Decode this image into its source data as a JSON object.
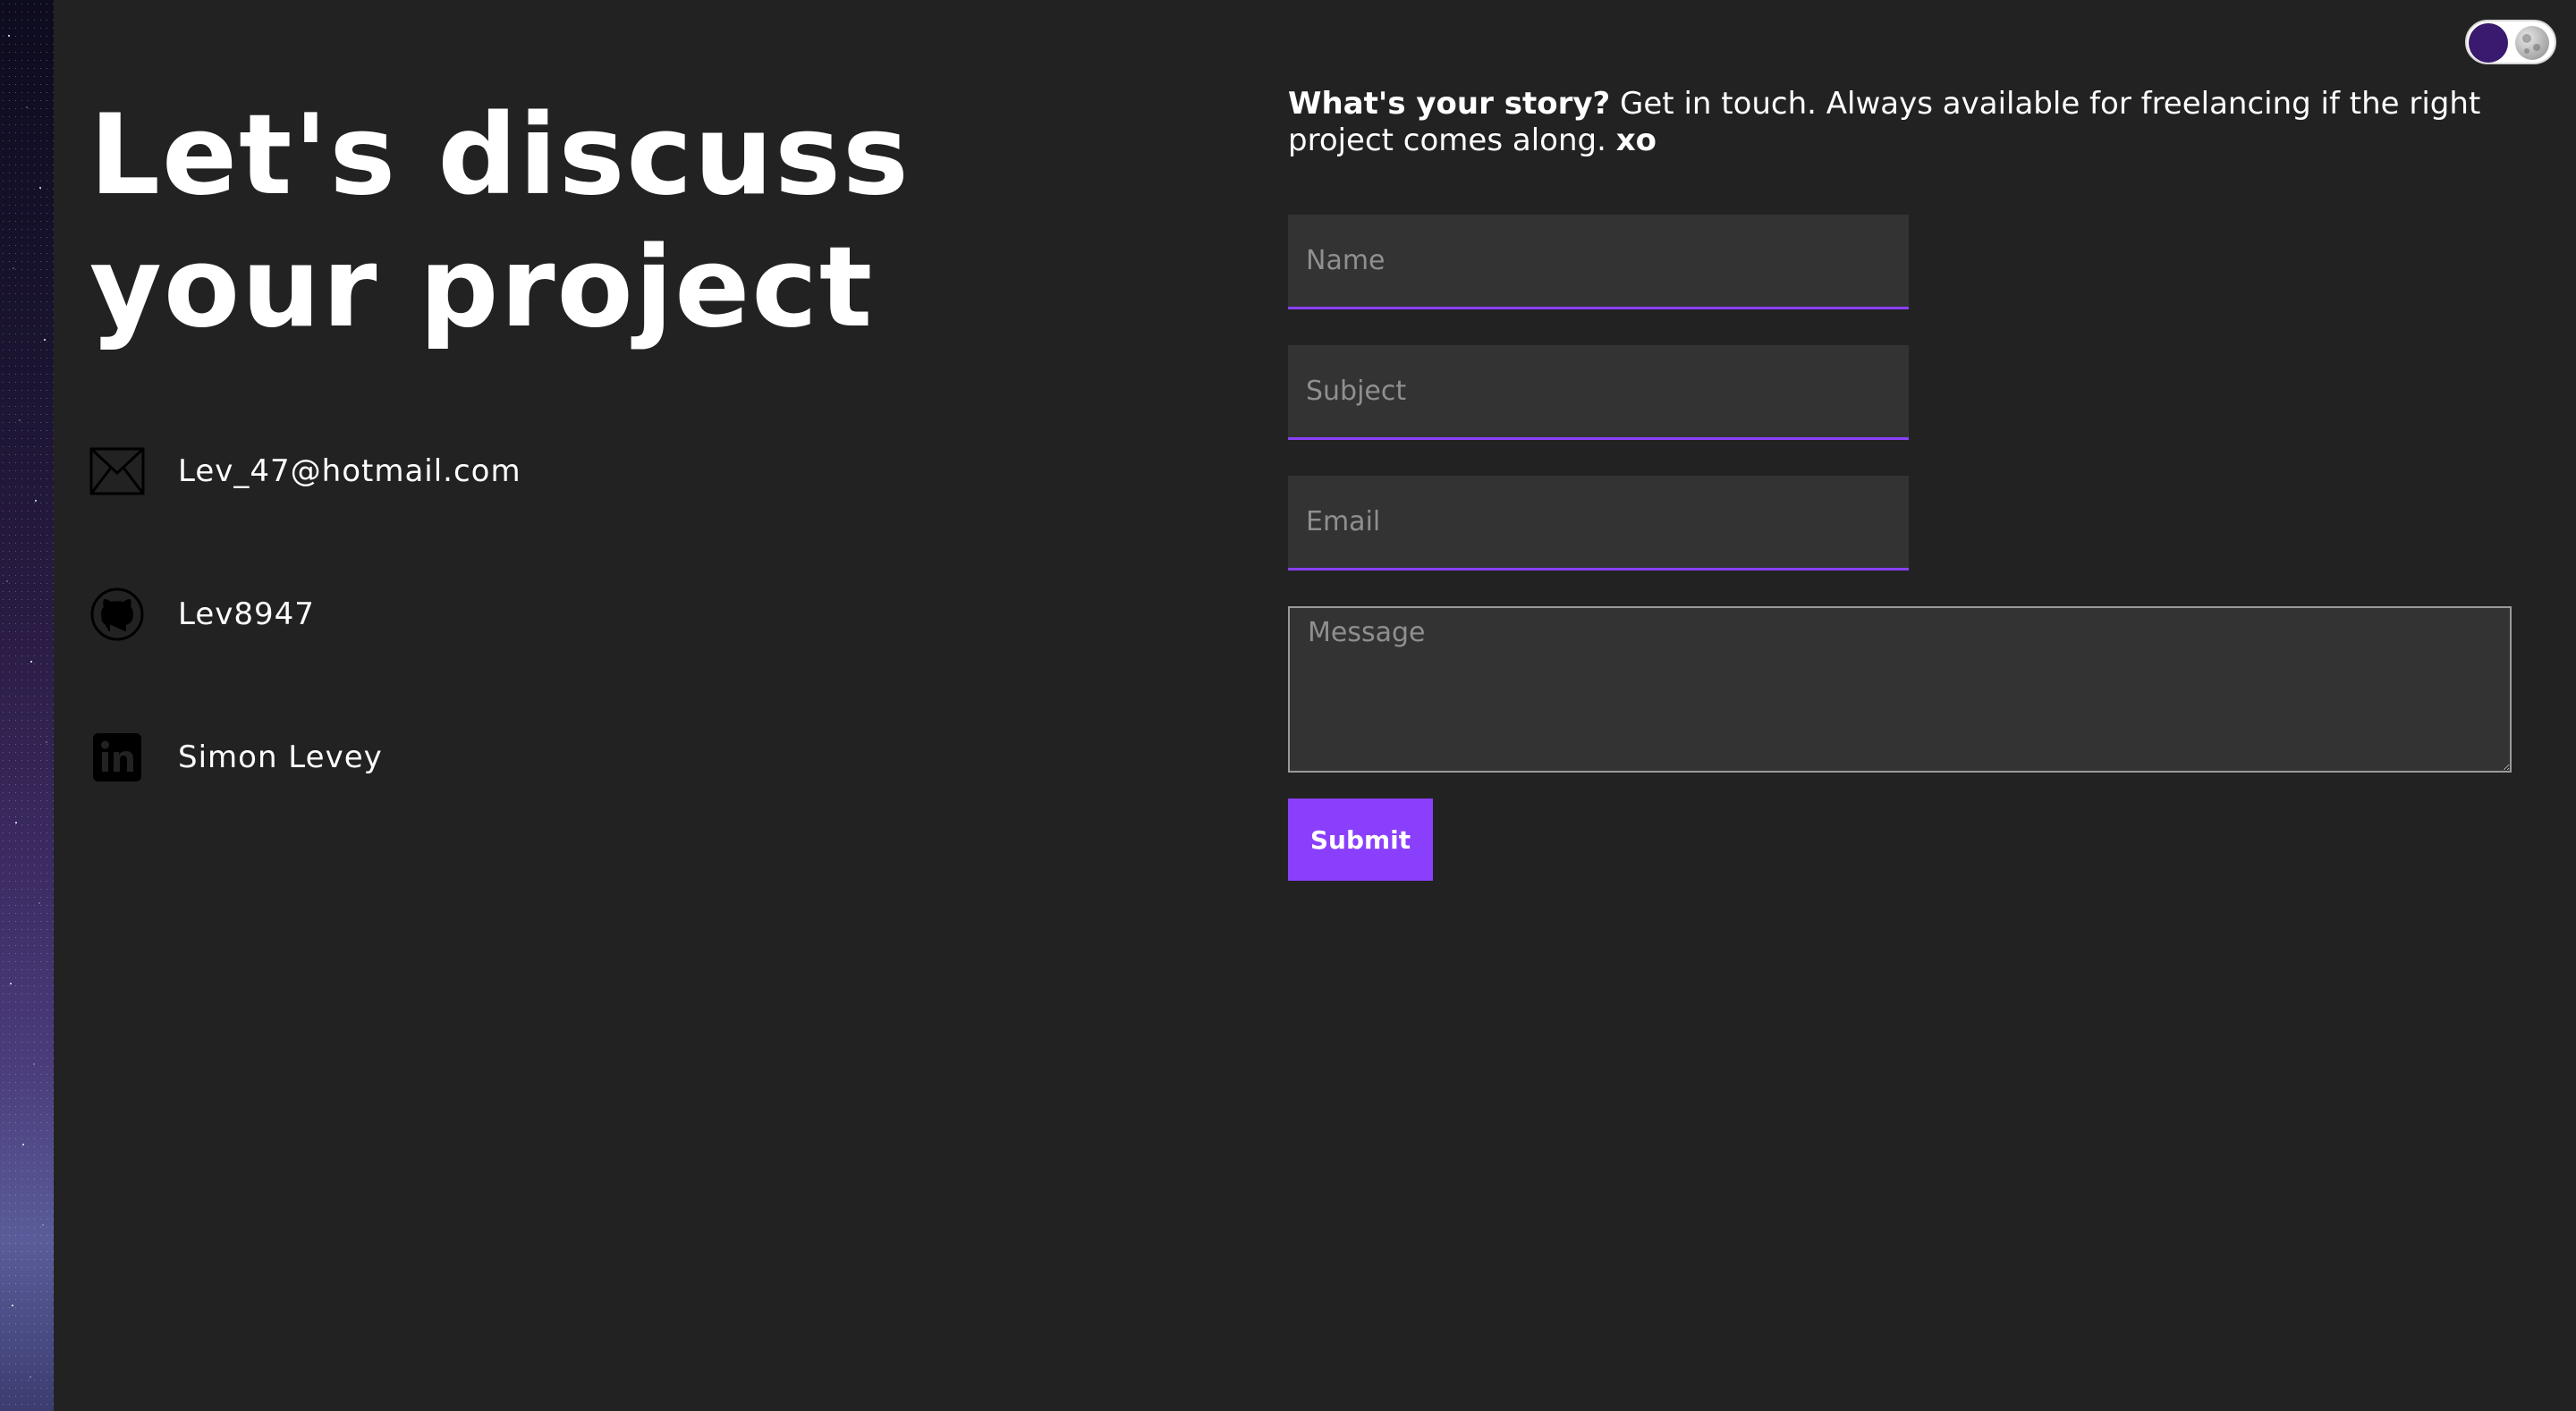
{
  "colors": {
    "background": "#222222",
    "accent": "#8a3ffc",
    "field_background": "#333333",
    "toggle_knob": "#3a1a6e"
  },
  "theme_toggle": {
    "icon": "moon-icon"
  },
  "hero": {
    "title_line1": "Let's discuss",
    "title_line2": "your project"
  },
  "contacts": [
    {
      "icon": "envelope-icon",
      "text": "Lev_47@hotmail.com"
    },
    {
      "icon": "github-icon",
      "text": "Lev8947"
    },
    {
      "icon": "linkedin-icon",
      "text": "Simon Levey"
    }
  ],
  "intro": {
    "lead": "What's your story?",
    "body": " Get in touch. Always available for freelancing if the right project comes along. ",
    "sign_off": "xo"
  },
  "form": {
    "name_placeholder": "Name",
    "subject_placeholder": "Subject",
    "email_placeholder": "Email",
    "message_placeholder": "Message",
    "submit_label": "Submit"
  }
}
